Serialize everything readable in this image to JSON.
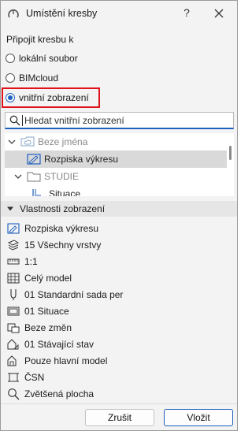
{
  "window": {
    "title": "Umístění kresby",
    "help_glyph": "?"
  },
  "attach_label": "Připojit kresbu k",
  "radios": [
    {
      "label": "lokální soubor",
      "checked": false
    },
    {
      "label": "BIMcloud",
      "checked": false
    },
    {
      "label": "vnitřní zobrazení",
      "checked": true
    }
  ],
  "search": {
    "placeholder": "Hledat vnitřní zobrazení"
  },
  "tree": {
    "items": [
      {
        "label": "Beze jména",
        "icon": "project-cloud-icon",
        "expanded": true,
        "dimmed": true
      },
      {
        "label": "Rozpiska výkresu",
        "icon": "layout-view-icon",
        "selected": true
      },
      {
        "label": "STUDIE",
        "icon": "folder-icon",
        "expanded": true,
        "dimmed": true
      },
      {
        "label": "Situace",
        "icon": "view-icon"
      }
    ]
  },
  "properties": {
    "header": "Vlastnosti zobrazení",
    "items": [
      {
        "label": "Rozpiska výkresu",
        "icon": "layout-view-icon"
      },
      {
        "label": "15 Všechny vrstvy",
        "icon": "layers-icon"
      },
      {
        "label": "1:1",
        "icon": "scale-icon"
      },
      {
        "label": "Celý model",
        "icon": "model-view-icon"
      },
      {
        "label": "01 Standardní sada per",
        "icon": "pen-set-icon"
      },
      {
        "label": "01 Situace",
        "icon": "mvo-icon"
      },
      {
        "label": "Beze změn",
        "icon": "override-icon"
      },
      {
        "label": "01 Stávající stav",
        "icon": "renovation-icon"
      },
      {
        "label": "Pouze hlavní model",
        "icon": "structural-icon"
      },
      {
        "label": "ČSN",
        "icon": "dimension-icon"
      },
      {
        "label": "Zvětšená plocha",
        "icon": "zoom-icon"
      }
    ]
  },
  "buttons": {
    "cancel": "Zrušit",
    "place": "Vložit"
  },
  "colors": {
    "accent": "#1f5fbf",
    "highlight_border": "#e0131c",
    "selection": "#d9d9d9"
  }
}
